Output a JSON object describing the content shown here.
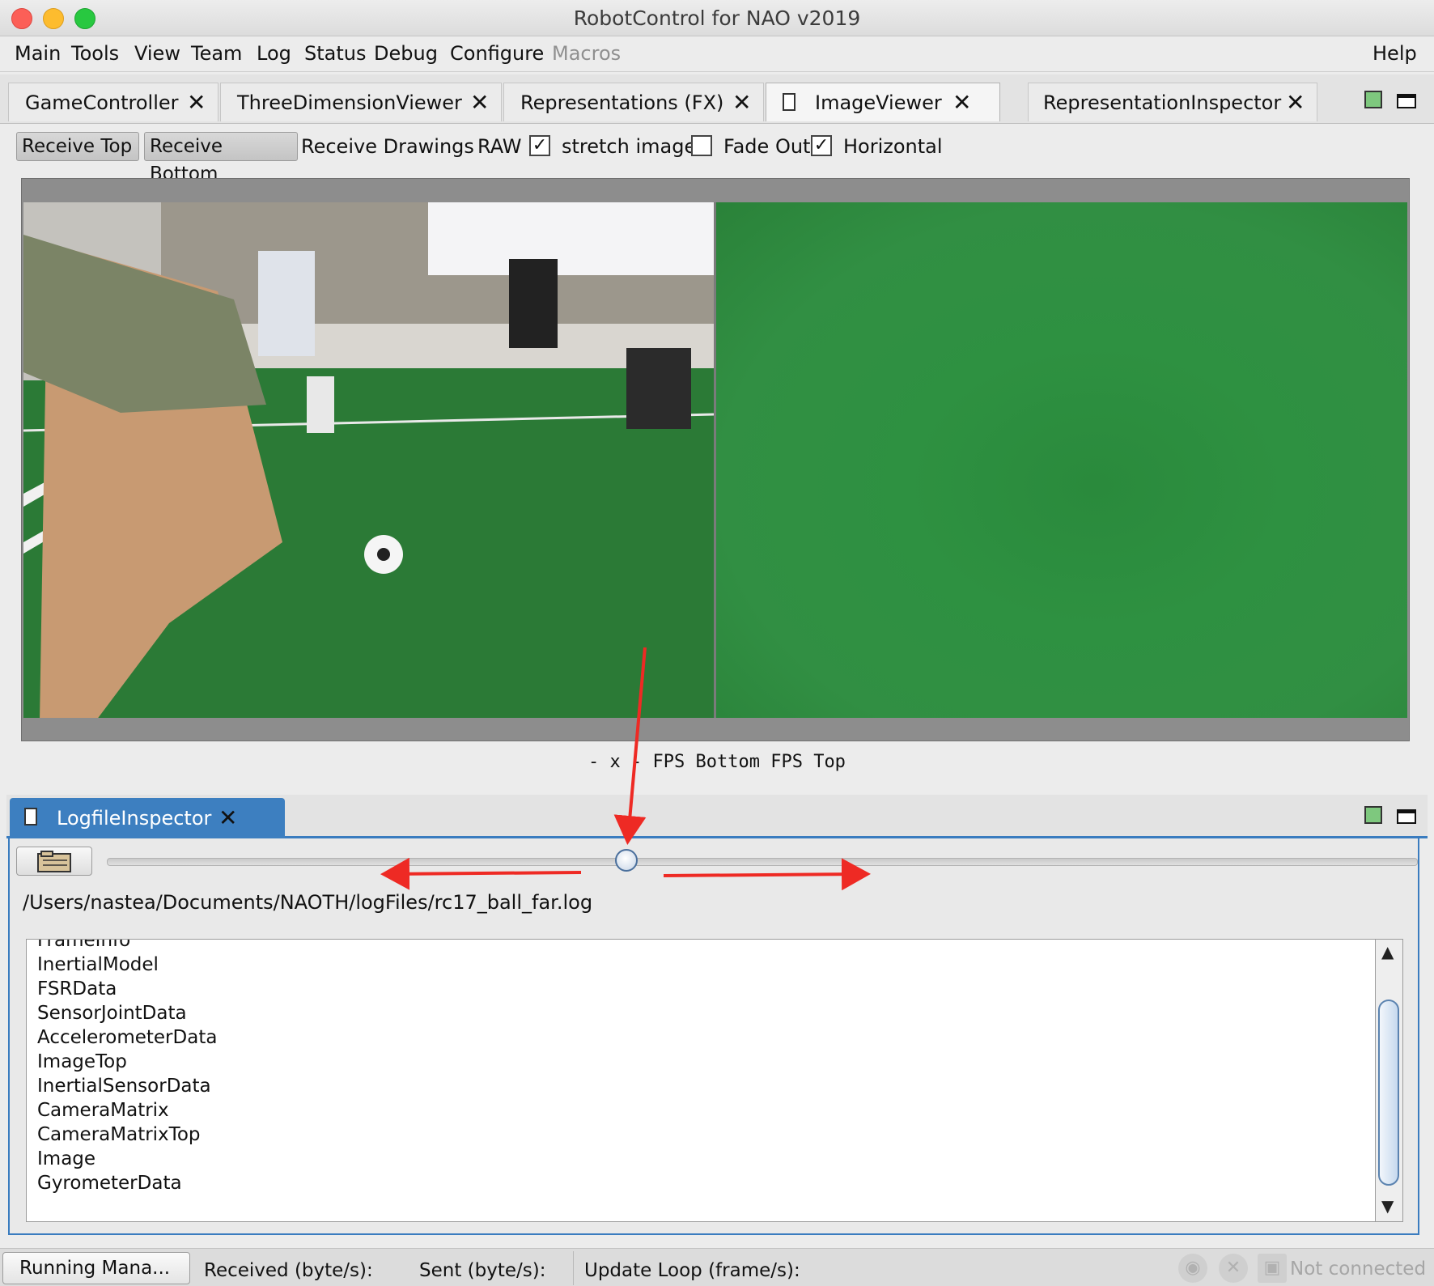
{
  "window": {
    "title": "RobotControl for NAO v2019"
  },
  "menu": [
    "Main",
    "Tools",
    "View",
    "Team",
    "Log",
    "Status",
    "Debug",
    "Configure",
    "Macros",
    "Help"
  ],
  "top_tabs": [
    {
      "label": "GameController",
      "active": false
    },
    {
      "label": "ThreeDimensionViewer",
      "active": false
    },
    {
      "label": "Representations (FX)",
      "active": false
    },
    {
      "label": "ImageViewer",
      "active": true
    },
    {
      "label": "RepresentationInspector",
      "active": false
    }
  ],
  "toolbar": {
    "receive_top": "Receive Top",
    "receive_bottom": "Receive Bottom",
    "receive_drawings": "Receive Drawings",
    "raw": "RAW",
    "raw_checked": true,
    "stretch_image": "stretch image",
    "stretch_checked": false,
    "fade_out": "Fade Out",
    "fade_out_checked": true,
    "horizontal": "Horizontal"
  },
  "viewer": {
    "fps_text": "- x - FPS Bottom FPS Top"
  },
  "log_panel": {
    "tab_label": "LogfileInspector",
    "file_path": "/Users/nastea/Documents/NAOTH/logFiles/rc17_ball_far.log",
    "slider_position": 0.4,
    "items": [
      "FrameInfo",
      "InertialModel",
      "FSRData",
      "SensorJointData",
      "AccelerometerData",
      "ImageTop",
      "InertialSensorData",
      "CameraMatrix",
      "CameraMatrixTop",
      "Image",
      "GyrometerData"
    ]
  },
  "status": {
    "running": "Running Mana...",
    "received": "Received (byte/s):",
    "sent": "Sent (byte/s):",
    "update_loop": "Update Loop (frame/s):",
    "connection": "Not connected"
  },
  "colors": {
    "accent": "#3d7fc0",
    "annotation_arrow": "#ee2a24"
  }
}
